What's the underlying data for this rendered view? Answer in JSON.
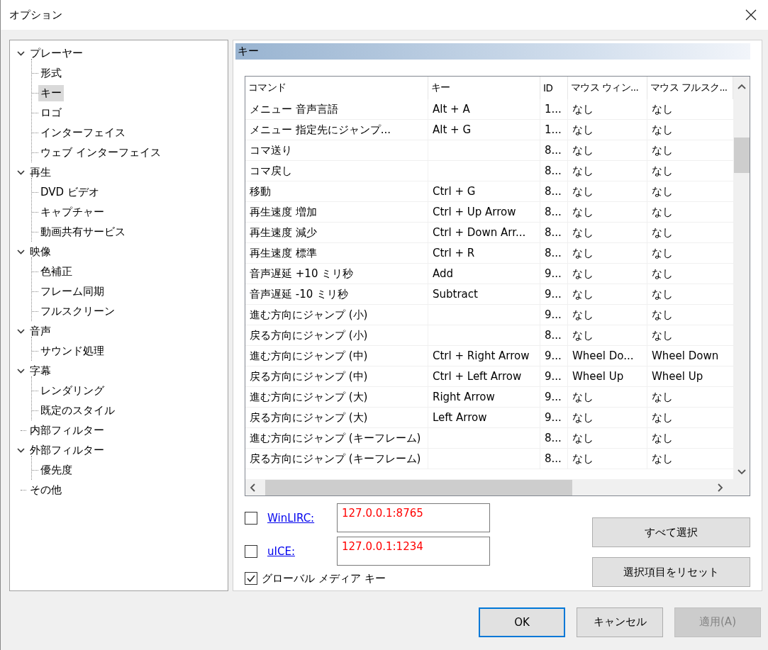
{
  "window": {
    "title": "オプション"
  },
  "tree": [
    {
      "label": "プレーヤー",
      "selected": false,
      "expanded": true,
      "children": [
        {
          "label": "形式",
          "selected": false
        },
        {
          "label": "キー",
          "selected": true
        },
        {
          "label": "ロゴ",
          "selected": false
        },
        {
          "label": "インターフェイス",
          "selected": false
        },
        {
          "label": "ウェブ インターフェイス",
          "selected": false
        }
      ]
    },
    {
      "label": "再生",
      "selected": false,
      "expanded": true,
      "children": [
        {
          "label": "DVD ビデオ",
          "selected": false
        },
        {
          "label": "キャプチャー",
          "selected": false
        },
        {
          "label": "動画共有サービス",
          "selected": false
        }
      ]
    },
    {
      "label": "映像",
      "selected": false,
      "expanded": true,
      "children": [
        {
          "label": "色補正",
          "selected": false
        },
        {
          "label": "フレーム同期",
          "selected": false
        },
        {
          "label": "フルスクリーン",
          "selected": false
        }
      ]
    },
    {
      "label": "音声",
      "selected": false,
      "expanded": true,
      "children": [
        {
          "label": "サウンド処理",
          "selected": false
        }
      ]
    },
    {
      "label": "字幕",
      "selected": false,
      "expanded": true,
      "children": [
        {
          "label": "レンダリング",
          "selected": false
        },
        {
          "label": "既定のスタイル",
          "selected": false
        }
      ]
    },
    {
      "label": "内部フィルター",
      "selected": false
    },
    {
      "label": "外部フィルター",
      "selected": false,
      "expanded": true,
      "children": [
        {
          "label": "優先度",
          "selected": false
        }
      ]
    },
    {
      "label": "その他",
      "selected": false
    }
  ],
  "section_title": "キー",
  "table": {
    "columns": [
      "コマンド",
      "キー",
      "ID",
      "マウス ウィン...",
      "マウス フルスク..."
    ],
    "rows": [
      {
        "command": "メニュー 音声言語",
        "key": "Alt + A",
        "id": "1...",
        "mouse_window": "なし",
        "mouse_fullscreen": "なし"
      },
      {
        "command": "メニュー 指定先にジャンプ...",
        "key": "Alt + G",
        "id": "1...",
        "mouse_window": "なし",
        "mouse_fullscreen": "なし"
      },
      {
        "command": "コマ送り",
        "id": "8...",
        "mouse_window": "なし",
        "mouse_fullscreen": "なし"
      },
      {
        "command": "コマ戻し",
        "id": "8...",
        "mouse_window": "なし",
        "mouse_fullscreen": "なし"
      },
      {
        "command": "移動",
        "key": "Ctrl + G",
        "id": "8...",
        "mouse_window": "なし",
        "mouse_fullscreen": "なし"
      },
      {
        "command": "再生速度 増加",
        "key": "Ctrl + Up Arrow",
        "id": "8...",
        "mouse_window": "なし",
        "mouse_fullscreen": "なし"
      },
      {
        "command": "再生速度 減少",
        "key": "Ctrl + Down Arr...",
        "id": "8...",
        "mouse_window": "なし",
        "mouse_fullscreen": "なし"
      },
      {
        "command": "再生速度 標準",
        "key": "Ctrl + R",
        "id": "8...",
        "mouse_window": "なし",
        "mouse_fullscreen": "なし"
      },
      {
        "command": "音声遅延 +10 ミリ秒",
        "key": "Add",
        "id": "9...",
        "mouse_window": "なし",
        "mouse_fullscreen": "なし"
      },
      {
        "command": "音声遅延 -10 ミリ秒",
        "key": "Subtract",
        "id": "9...",
        "mouse_window": "なし",
        "mouse_fullscreen": "なし"
      },
      {
        "command": "進む方向にジャンプ (小)",
        "id": "9...",
        "mouse_window": "なし",
        "mouse_fullscreen": "なし"
      },
      {
        "command": "戻る方向にジャンプ (小)",
        "id": "8...",
        "mouse_window": "なし",
        "mouse_fullscreen": "なし"
      },
      {
        "command": "進む方向にジャンプ (中)",
        "key": "Ctrl + Right Arrow",
        "id": "9...",
        "mouse_window": "Wheel Do...",
        "mouse_fullscreen": "Wheel Down"
      },
      {
        "command": "戻る方向にジャンプ (中)",
        "key": "Ctrl + Left Arrow",
        "id": "9...",
        "mouse_window": "Wheel Up",
        "mouse_fullscreen": "Wheel Up"
      },
      {
        "command": "進む方向にジャンプ (大)",
        "key": "Right Arrow",
        "id": "9...",
        "mouse_window": "なし",
        "mouse_fullscreen": "なし"
      },
      {
        "command": "戻る方向にジャンプ (大)",
        "key": "Left Arrow",
        "id": "9...",
        "mouse_window": "なし",
        "mouse_fullscreen": "なし"
      },
      {
        "command": "進む方向にジャンプ (キーフレーム)",
        "id": "8...",
        "mouse_window": "なし",
        "mouse_fullscreen": "なし"
      },
      {
        "command": "戻る方向にジャンプ (キーフレーム)",
        "id": "8...",
        "mouse_window": "なし",
        "mouse_fullscreen": "なし"
      }
    ]
  },
  "remotes": [
    {
      "label": "WinLIRC:",
      "checked": false,
      "value": "127.0.0.1:8765"
    },
    {
      "label": "uICE:",
      "checked": false,
      "value": "127.0.0.1:1234"
    }
  ],
  "global_media_keys": {
    "label": "グローバル メディア キー",
    "checked": true
  },
  "side_buttons": [
    "すべて選択",
    "選択項目をリセット"
  ],
  "buttons": [
    {
      "label": "OK",
      "default": true,
      "disabled": false
    },
    {
      "label": "キャンセル",
      "default": false,
      "disabled": false
    },
    {
      "label": "適用(A)",
      "default": false,
      "disabled": true
    }
  ]
}
